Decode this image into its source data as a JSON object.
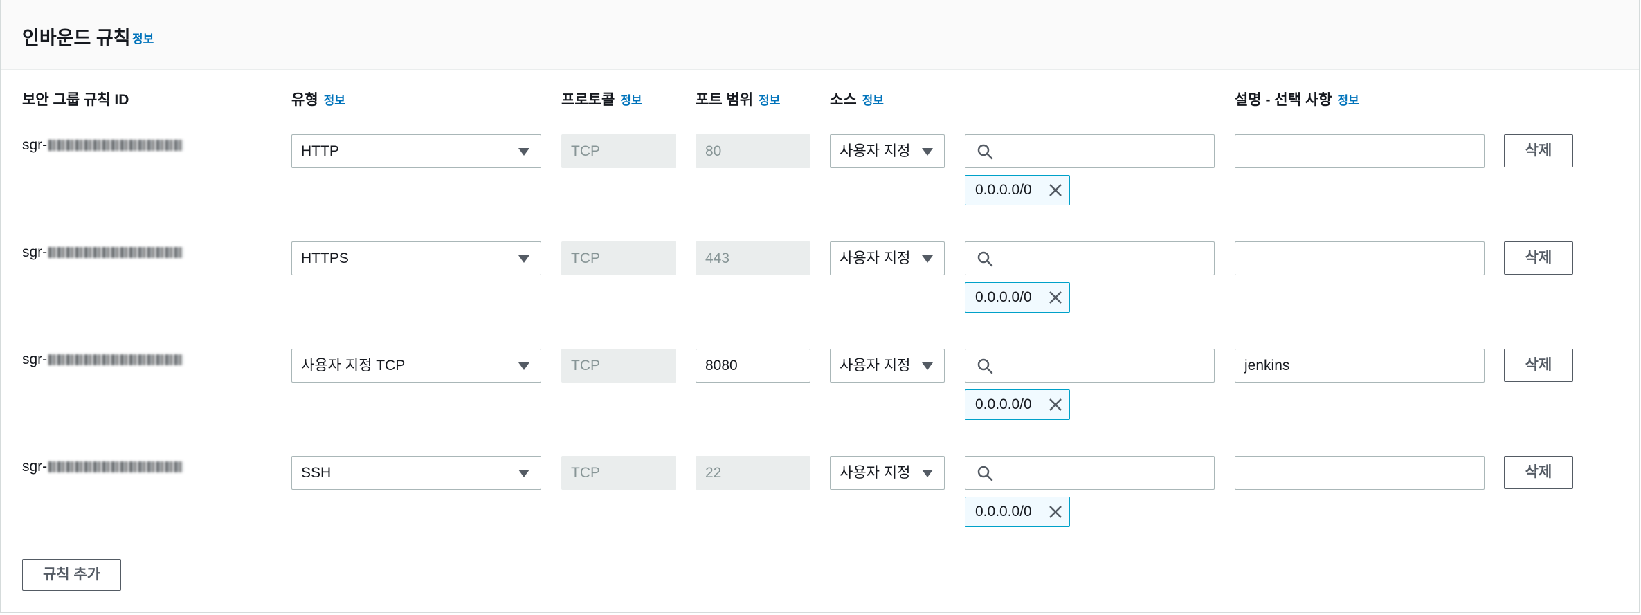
{
  "panel": {
    "title": "인바운드 규칙",
    "info_label": "정보"
  },
  "columns": {
    "rule_id": "보안 그룹 규칙 ID",
    "type": "유형",
    "protocol": "프로토콜",
    "port_range": "포트 범위",
    "source": "소스",
    "description": "설명 - 선택 사항",
    "info_label": "정보"
  },
  "rules": [
    {
      "id_prefix": "sgr-",
      "type": "HTTP",
      "protocol": "TCP",
      "port": "80",
      "source_type": "사용자 지정",
      "search_value": "",
      "cidr": "0.0.0.0/0",
      "description": "",
      "delete_label": "삭제"
    },
    {
      "id_prefix": "sgr-",
      "type": "HTTPS",
      "protocol": "TCP",
      "port": "443",
      "source_type": "사용자 지정",
      "search_value": "",
      "cidr": "0.0.0.0/0",
      "description": "",
      "delete_label": "삭제"
    },
    {
      "id_prefix": "sgr-",
      "type": "사용자 지정 TCP",
      "protocol": "TCP",
      "port": "8080",
      "source_type": "사용자 지정",
      "search_value": "",
      "cidr": "0.0.0.0/0",
      "description": "jenkins",
      "delete_label": "삭제"
    },
    {
      "id_prefix": "sgr-",
      "type": "SSH",
      "protocol": "TCP",
      "port": "22",
      "source_type": "사용자 지정",
      "search_value": "",
      "cidr": "0.0.0.0/0",
      "description": "",
      "delete_label": "삭제"
    }
  ],
  "add_rule_label": "규칙 추가",
  "colors": {
    "link": "#0073bb",
    "token_border": "#00a1c9",
    "token_bg": "#f1faff",
    "disabled_bg": "#eaeded"
  }
}
